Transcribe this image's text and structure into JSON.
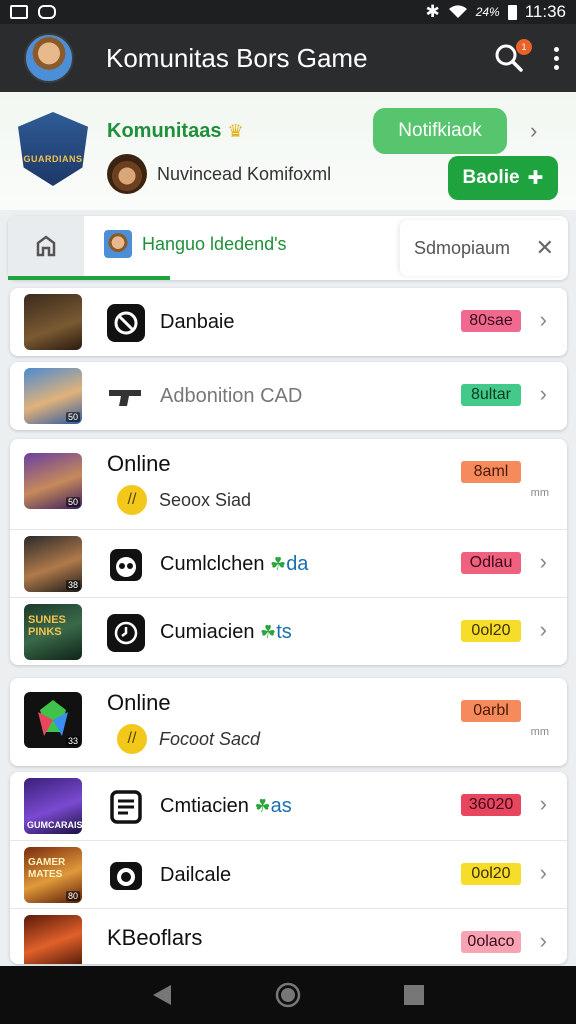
{
  "status_bar": {
    "battery": "24%",
    "time": "11:36"
  },
  "app_bar": {
    "title": "Komunitas Bors Game",
    "notification_count": "1"
  },
  "header": {
    "community_name": "Komunitaas",
    "crest_label": "GUARDIANS",
    "owner_name": "Nuvincead Komifoxml",
    "notification_button": "Notifkiaok",
    "join_button": "Baolie",
    "join_icon": "plus-icon"
  },
  "tabs": {
    "active_label": "Hanguo ldedend's",
    "search_chip": "Sdmopiaum"
  },
  "card1": {
    "label": "Danbaie",
    "pill": "80sae",
    "pill_bg": "#f06a8f",
    "pill_fg": "#3a0b1c"
  },
  "card2": {
    "label": "Adbonition CAD",
    "pill": "8ultar",
    "pill_bg": "#43c98a",
    "pill_fg": "#0d3b22"
  },
  "card3": {
    "title": "Online",
    "pill": "8aml",
    "pill_bg": "#f58a5c",
    "pill_fg": "#4a1a06",
    "sub": "Seoox Siad",
    "coin_glyph": "//",
    "meta": "mm",
    "rows": [
      {
        "label": "Cumlclchen",
        "tag": "da",
        "pill": "Odlau",
        "pill_bg": "#f0617f",
        "pill_fg": "#3a0b1c"
      },
      {
        "label": "Cumiacien",
        "tag": "ts",
        "pill": "0ol20",
        "pill_bg": "#f5dd2a",
        "pill_fg": "#3b3000"
      }
    ]
  },
  "card4": {
    "title": "Online",
    "pill": "0arbl",
    "pill_bg": "#f58a5c",
    "pill_fg": "#4a1a06",
    "sub": "Focoot Sacd",
    "coin_glyph": "//",
    "meta": "mm"
  },
  "card5": {
    "thumb_label": "GUMCARAIS",
    "rows": [
      {
        "label": "Cmtiacien",
        "tag": "as",
        "pill": "36020",
        "pill_bg": "#e8465e",
        "pill_fg": "#3a0b1c"
      },
      {
        "label": "Dailcale",
        "pill": "0ol20",
        "pill_bg": "#f5dd2a",
        "pill_fg": "#3b3000"
      },
      {
        "label": "KBeoflars",
        "pill": "0olaco",
        "pill_bg": "#f7a3b4",
        "pill_fg": "#3a0b1c"
      }
    ]
  },
  "thumb_texts": {
    "sunes": "SUNES\nPINKS",
    "gamers": "GAMER\nMATES"
  },
  "thumb_levels": [
    "",
    "50",
    "50",
    "38",
    "",
    "33",
    "",
    "80",
    ""
  ]
}
